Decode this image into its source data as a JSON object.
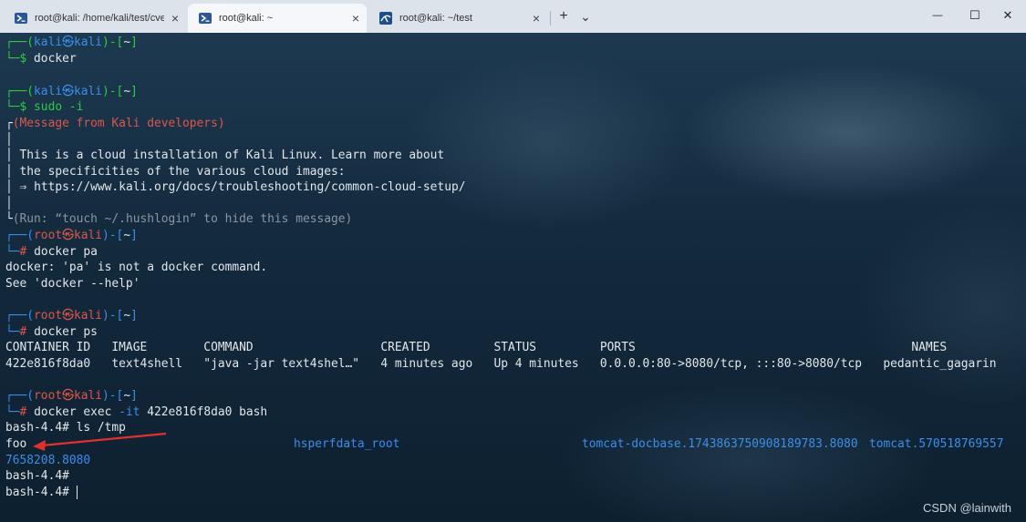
{
  "tabs": [
    {
      "label": "root@kali: /home/kali/test/cve",
      "close": "×",
      "active": false,
      "icon": "powershell-icon"
    },
    {
      "label": "root@kali: ~",
      "close": "×",
      "active": true,
      "icon": "powershell-icon"
    },
    {
      "label": "root@kali: ~/test",
      "close": "×",
      "active": false,
      "icon": "kali-icon"
    }
  ],
  "toolbar": {
    "new_tab": "+",
    "dropdown": "⌄"
  },
  "window": {
    "minimize": "—",
    "maximize": "☐",
    "close": "✕"
  },
  "terminal": {
    "p1_user": "kali",
    "p1_host": "kali",
    "p1_cmd": "docker",
    "p2_user": "kali",
    "p2_host": "kali",
    "p2_cmd": "sudo -i",
    "msg_header": "(Message from Kali developers)",
    "msg_line1": "This is a cloud installation of Kali Linux. Learn more about",
    "msg_line2": "the specificities of the various cloud images:",
    "msg_link_arrow": "⇒",
    "msg_link": "https://www.kali.org/docs/troubleshooting/common-cloud-setup/",
    "msg_footer": "(Run: “touch ~/.hushlogin” to hide this message)",
    "p3_user": "root",
    "p3_host": "kali",
    "p3_cmd": "docker pa",
    "err1": "docker: 'pa' is not a docker command.",
    "err2": "See 'docker --help'",
    "p4_user": "root",
    "p4_host": "kali",
    "p4_cmd": "docker ps",
    "ps_header": "CONTAINER ID   IMAGE        COMMAND                  CREATED         STATUS         PORTS                                       NAMES",
    "ps_row": "422e816f8da0   text4shell   \"java -jar text4shel…\"   4 minutes ago   Up 4 minutes   0.0.0.0:80->8080/tcp, :::80->8080/tcp   pedantic_gagarin",
    "p5_user": "root",
    "p5_host": "kali",
    "p5_cmd_a": "docker exec ",
    "p5_cmd_flag": "-it",
    "p5_cmd_b": " 422e816f8da0 bash",
    "bash_ls": "bash-4.4# ls /tmp",
    "ls_foo": "foo",
    "ls_hsperf": "hsperfdata_root",
    "ls_tomcat_docbase": "tomcat-docbase.1743863750908189783.8080",
    "ls_tomcat": "tomcat.570518769557",
    "ls_tomcat_wrap": "7658208.8080",
    "bash_empty": "bash-4.4#",
    "bash_last": "bash-4.4# "
  },
  "watermark": "CSDN @lainwith",
  "colors": {
    "prompt_green": "#2ecc40",
    "prompt_blue": "#3b8eea",
    "root_red": "#e0554a",
    "annotation_arrow": "#e03030"
  }
}
